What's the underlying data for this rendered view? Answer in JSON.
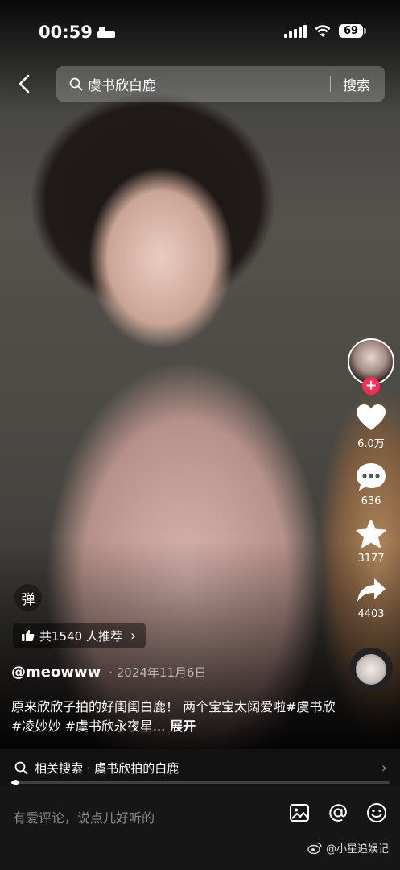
{
  "status_bar": {
    "time": "00:59",
    "battery": "69"
  },
  "search": {
    "query": "虞书欣白鹿",
    "button_label": "搜索"
  },
  "rail": {
    "follow_symbol": "+",
    "likes": "6.0万",
    "comments": "636",
    "favorites": "3177",
    "shares": "4403"
  },
  "danmu_label": "弹",
  "recommend": {
    "label": "共1540 人推荐",
    "chevron": "›"
  },
  "post": {
    "author": "@meowww",
    "date": "· 2024年11月6日",
    "description": "原来欣欣子拍的好闺闺白鹿！ 两个宝宝太阔爱啦#虞书欣 #凌妙妙 #虞书欣永夜星...",
    "more_label": "展开"
  },
  "related": {
    "label": "相关搜索 · 虞书欣拍的白鹿",
    "chevron": "›",
    "progress": 0.01
  },
  "comment": {
    "placeholder": "有爱评论，说点儿好听的"
  },
  "watermark": "@小星追娱记",
  "colors": {
    "accent": "#fe2c55",
    "background": "#000000"
  }
}
